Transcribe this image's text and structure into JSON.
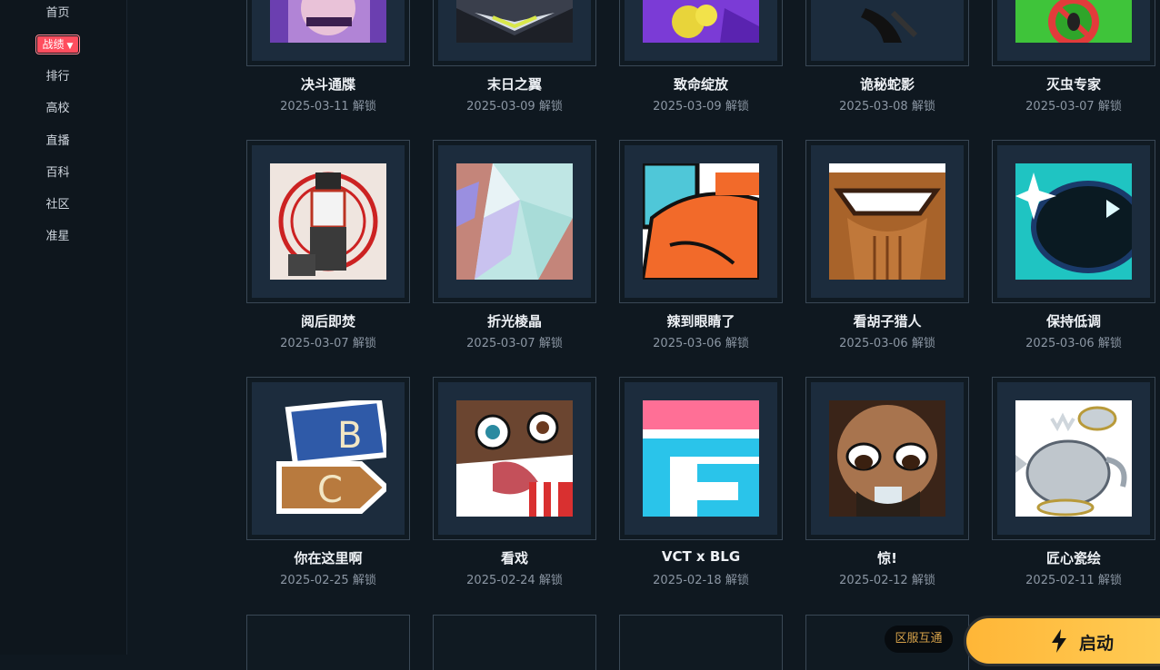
{
  "sidebar": {
    "items": [
      {
        "label": "首页"
      },
      {
        "label": "战绩",
        "active": true
      },
      {
        "label": "排行"
      },
      {
        "label": "高校"
      },
      {
        "label": "直播"
      },
      {
        "label": "百科"
      },
      {
        "label": "社区"
      },
      {
        "label": "准星"
      }
    ]
  },
  "unlock_label": "解锁",
  "sprays": [
    {
      "title": "决斗通牒",
      "date": "2025-03-11 解锁",
      "icon": "duelist-spray"
    },
    {
      "title": "末日之翼",
      "date": "2025-03-09 解锁",
      "icon": "doom-wing-spray"
    },
    {
      "title": "致命绽放",
      "date": "2025-03-09 解锁",
      "icon": "deadly-bloom-spray"
    },
    {
      "title": "诡秘蛇影",
      "date": "2025-03-08 解锁",
      "icon": "shadow-snake-spray"
    },
    {
      "title": "灭虫专家",
      "date": "2025-03-07 解锁",
      "icon": "bug-exterminator-spray"
    },
    {
      "title": "阅后即焚",
      "date": "2025-03-07 解锁",
      "icon": "burn-after-reading-spray"
    },
    {
      "title": "折光棱晶",
      "date": "2025-03-07 解锁",
      "icon": "prism-spray"
    },
    {
      "title": "辣到眼睛了",
      "date": "2025-03-06 解锁",
      "icon": "spicy-eyes-spray"
    },
    {
      "title": "看胡子猎人",
      "date": "2025-03-06 解锁",
      "icon": "beard-hunter-spray"
    },
    {
      "title": "保持低调",
      "date": "2025-03-06 解锁",
      "icon": "low-profile-spray"
    },
    {
      "title": "你在这里啊",
      "date": "2025-02-25 解锁",
      "icon": "there-you-are-spray"
    },
    {
      "title": "看戏",
      "date": "2025-02-24 解锁",
      "icon": "popcorn-spray"
    },
    {
      "title": "VCT x BLG",
      "date": "2025-02-18 解锁",
      "icon": "vct-blg-spray"
    },
    {
      "title": "惊!",
      "date": "2025-02-12 解锁",
      "icon": "shocked-spray"
    },
    {
      "title": "匠心瓷绘",
      "date": "2025-02-11 解锁",
      "icon": "teapot-spray"
    }
  ],
  "footer": {
    "region_badge": "区服互通",
    "launch_label": "启动"
  },
  "colors": {
    "accent": "#ff4d5e",
    "launch": "#ffbf45",
    "background": "#0f1820"
  }
}
